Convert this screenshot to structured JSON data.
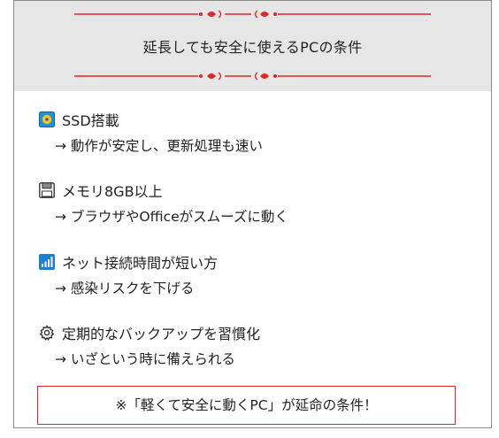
{
  "header": {
    "title": "延長しても安全に使えるPCの条件"
  },
  "items": [
    {
      "icon": "ssd-icon",
      "title": "SSD搭載",
      "detail": "→ 動作が安定し、更新処理も速い"
    },
    {
      "icon": "floppy-disk-icon",
      "title": "メモリ8GB以上",
      "detail": "→ ブラウザやOfficeがスムーズに動く"
    },
    {
      "icon": "signal-bars-icon",
      "title": "ネット接続時間が短い方",
      "detail": "→ 感染リスクを下げる"
    },
    {
      "icon": "gear-icon",
      "title": "定期的なバックアップを習慣化",
      "detail": "→ いざという時に備えられる"
    }
  ],
  "callout": {
    "text": "※「軽くて安全に動くPC」が延命の条件！"
  },
  "colors": {
    "accent_red": "#e0262b",
    "header_bg": "#e6e6e6",
    "border": "#8a8a8a"
  }
}
